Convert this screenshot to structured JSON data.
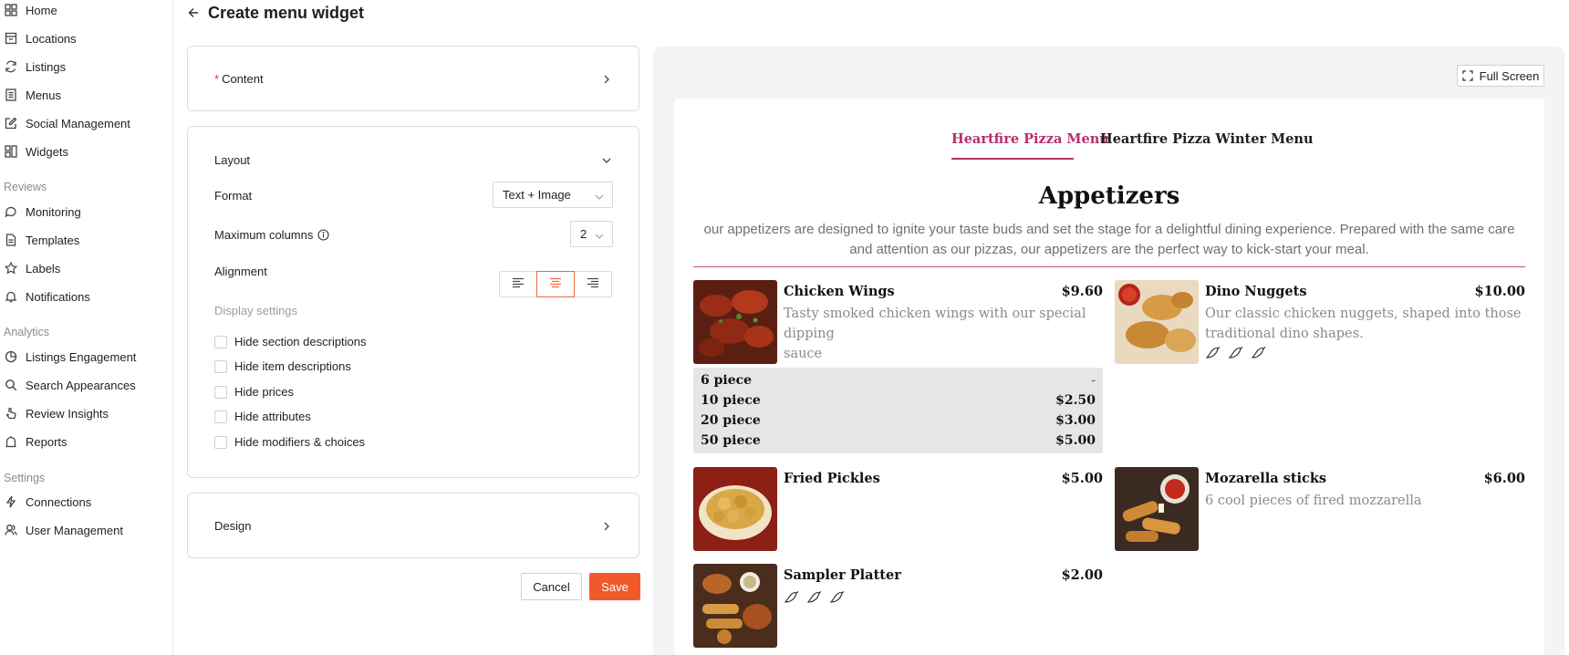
{
  "sidebar": {
    "items": [
      {
        "label": "Home",
        "icon": "home-grid-icon"
      },
      {
        "label": "Locations",
        "icon": "store-icon"
      },
      {
        "label": "Listings",
        "icon": "sync-icon"
      },
      {
        "label": "Menus",
        "icon": "menu-book-icon"
      },
      {
        "label": "Social Management",
        "icon": "edit-icon"
      },
      {
        "label": "Widgets",
        "icon": "widgets-icon"
      }
    ],
    "reviews_section": "Reviews",
    "reviews_items": [
      {
        "label": "Monitoring",
        "icon": "chat-icon"
      },
      {
        "label": "Templates",
        "icon": "document-icon"
      },
      {
        "label": "Labels",
        "icon": "star-icon"
      },
      {
        "label": "Notifications",
        "icon": "bell-icon"
      }
    ],
    "analytics_section": "Analytics",
    "analytics_items": [
      {
        "label": "Listings Engagement",
        "icon": "pie-chart-icon"
      },
      {
        "label": "Search Appearances",
        "icon": "search-icon"
      },
      {
        "label": "Review Insights",
        "icon": "hand-pointer-icon"
      },
      {
        "label": "Reports",
        "icon": "report-icon"
      }
    ],
    "settings_section": "Settings",
    "settings_items": [
      {
        "label": "Connections",
        "icon": "lightning-icon"
      },
      {
        "label": "User Management",
        "icon": "users-icon"
      }
    ]
  },
  "header": {
    "title": "Create menu widget"
  },
  "content_panel": {
    "required_mark": "*",
    "label": "Content"
  },
  "layout_panel": {
    "label": "Layout",
    "format_label": "Format",
    "format_value": "Text + Image",
    "max_columns_label": "Maximum columns",
    "max_columns_value": "2",
    "alignment_label": "Alignment",
    "alignment_selected": "center",
    "display_settings_label": "Display settings",
    "checkboxes": [
      "Hide section descriptions",
      "Hide item descriptions",
      "Hide prices",
      "Hide attributes",
      "Hide modifiers & choices"
    ]
  },
  "design_panel": {
    "label": "Design"
  },
  "actions": {
    "cancel": "Cancel",
    "save": "Save"
  },
  "preview": {
    "fullscreen_label": "Full Screen",
    "tabs": [
      "Heartfire Pizza Menu",
      "Heartfire Pizza Winter Menu"
    ],
    "active_tab": 0,
    "section_title": "Appetizers",
    "section_desc_line1": "our appetizers are designed to ignite your taste buds and set the stage for a delightful dining experience. Prepared with the same care",
    "section_desc_line2": "and attention as our pizzas, our appetizers are the perfect way to kick-start your meal.",
    "items": [
      {
        "name": "Chicken Wings",
        "price": "$9.60",
        "desc_line1": "Tasty smoked chicken wings with our special dipping",
        "desc_line2": "sauce"
      },
      {
        "name": "Dino Nuggets",
        "price": "$10.00",
        "desc_line1": "Our classic chicken nuggets, shaped into those",
        "desc_line2": "traditional dino shapes.",
        "spice_level": 3
      },
      {
        "name": "Fried Pickles",
        "price": "$5.00"
      },
      {
        "name": "Mozarella sticks",
        "price": "$6.00",
        "desc_line1": "6 cool pieces of fired mozzarella"
      },
      {
        "name": "Sampler Platter",
        "price": "$2.00",
        "spice_level": 3
      }
    ],
    "modifiers": [
      {
        "label": "6 piece",
        "price": "-"
      },
      {
        "label": "10 piece",
        "price": "$2.50"
      },
      {
        "label": "20 piece",
        "price": "$3.00"
      },
      {
        "label": "50 piece",
        "price": "$5.00"
      }
    ],
    "accent_color": "#b5316a"
  },
  "colors": {
    "primary": "#f05a2b",
    "required": "#e53935"
  }
}
